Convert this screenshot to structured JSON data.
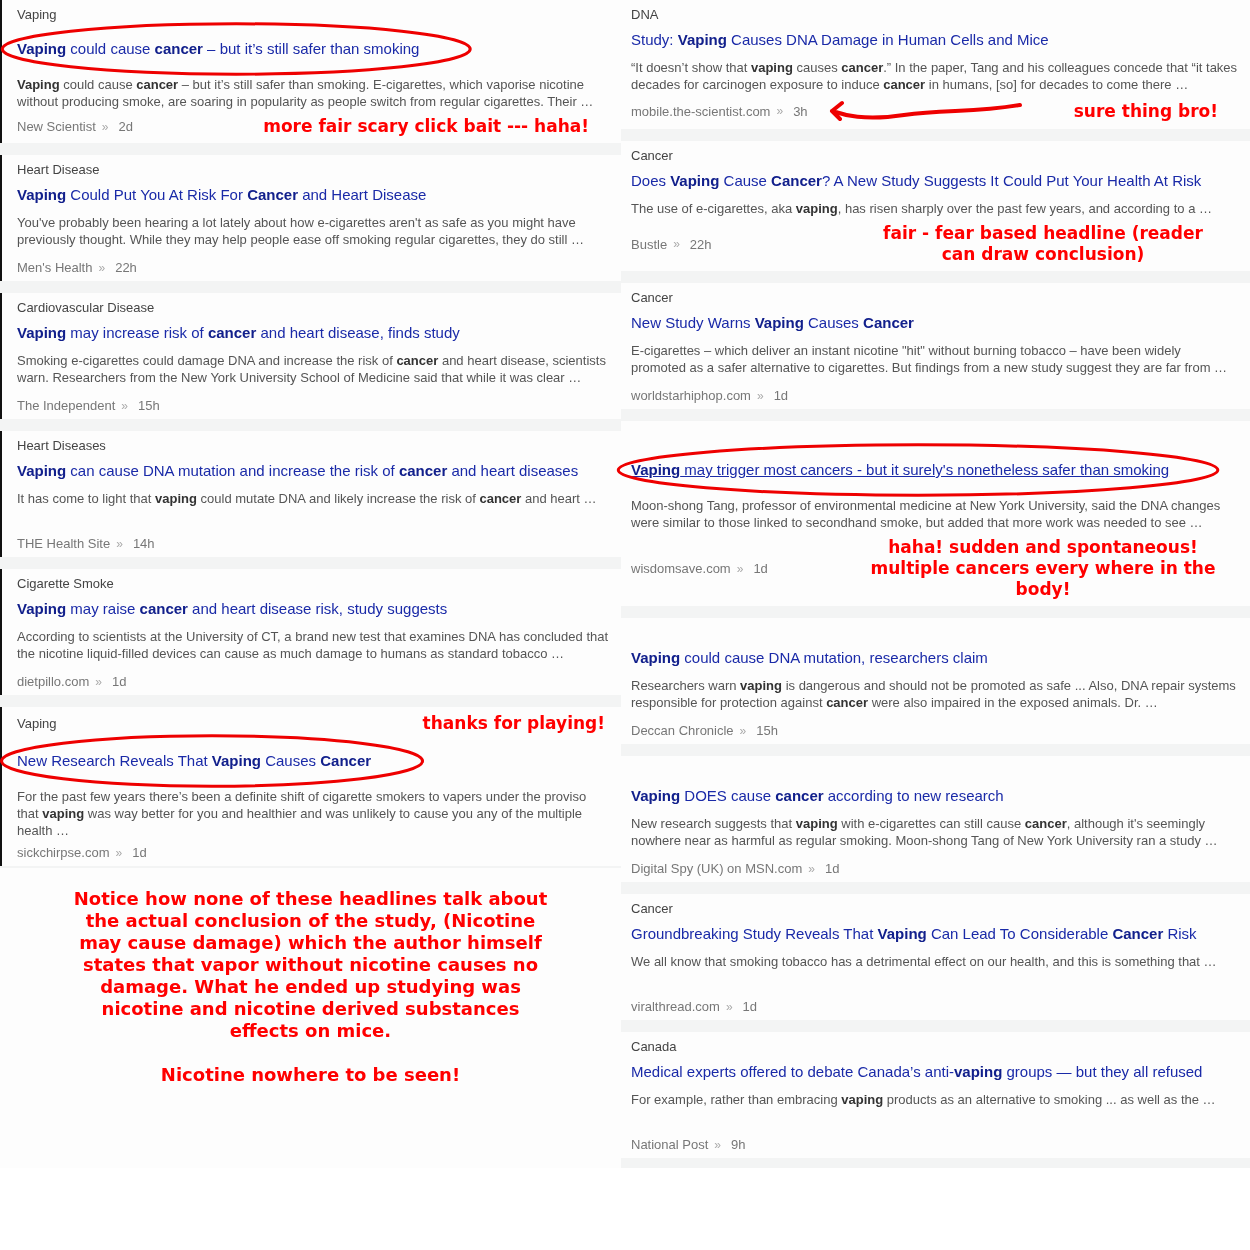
{
  "left": [
    {
      "topic": "Vaping",
      "headline": "**Vaping** could cause **cancer** – but it’s still safer than smoking",
      "snippet": "**Vaping** could cause **cancer** – but it’s still safer than smoking. E-cigarettes, which vaporise nicotine without producing smoke, are soaring in popularity as people switch from regular cigarettes. Their …",
      "source": "New Scientist",
      "separator": "»",
      "time": "2d",
      "circled": true,
      "underlined": false,
      "note": {
        "kind": "meta",
        "text": "more fair scary click bait --- haha!"
      }
    },
    {
      "topic": "Heart Disease",
      "headline": "**Vaping** Could Put You At Risk For **Cancer** and Heart Disease",
      "snippet": "You've probably been hearing a lot lately about how e-cigarettes aren't as safe as you might have previously thought. While they may help people ease off smoking regular cigarettes, they do still …",
      "source": "Men's Health",
      "separator": "»",
      "time": "22h",
      "circled": false,
      "underlined": false
    },
    {
      "topic": "Cardiovascular Disease",
      "headline": "**Vaping** may increase risk of **cancer** and heart disease, finds study",
      "snippet": "Smoking e-cigarettes could damage DNA and increase the risk of **cancer** and heart disease, scientists warn. Researchers from the New York University School of Medicine said that while it was clear …",
      "source": "The Independent",
      "separator": "»",
      "time": "15h",
      "circled": false,
      "underlined": false
    },
    {
      "topic": "Heart Diseases",
      "headline": "**Vaping** can cause DNA mutation and increase the risk of **cancer** and heart diseases",
      "snippet": "It has come to light that **vaping** could mutate DNA and likely increase the risk of **cancer** and heart …",
      "source": "THE Health Site",
      "separator": "»",
      "time": "14h",
      "circled": false,
      "underlined": false
    },
    {
      "topic": "Cigarette Smoke",
      "headline": "**Vaping** may raise **cancer** and heart disease risk, study suggests",
      "snippet": "According to scientists at the University of CT, a brand new test that examines DNA has concluded that the nicotine liquid-filled devices can cause as much damage to humans as standard tobacco …",
      "source": "dietpillo.com",
      "separator": "»",
      "time": "1d",
      "circled": false,
      "underlined": false
    },
    {
      "topic": "Vaping",
      "headline": "New Research Reveals That **Vaping** Causes **Cancer**",
      "snippet": "For the past few years there’s been a definite shift of cigarette smokers to vapers under the proviso that **vaping** was way better for you and healthier and was unlikely to cause you any of the multiple health …",
      "source": "sickchirpse.com",
      "separator": "»",
      "time": "1d",
      "circled": true,
      "underlined": false,
      "note": {
        "kind": "top",
        "text": "thanks for playing!"
      }
    }
  ],
  "commentary": [
    "Notice how none of these headlines talk about the actual conclusion of the study, (Nicotine may cause damage) which the author himself states that vapor without nicotine causes no damage. What he ended up studying was nicotine and nicotine derived substances effects on mice.",
    "Nicotine nowhere to be seen!"
  ],
  "right": [
    {
      "topic": "DNA",
      "headline": "Study: **Vaping** Causes DNA Damage in Human Cells and Mice",
      "snippet": "“It doesn’t show that **vaping** causes **cancer**.” In the paper, Tang and his colleagues concede that “it takes decades for carcinogen exposure to induce **cancer** in humans, [so] for decades to come there …",
      "source": "mobile.the-scientist.com",
      "separator": "»",
      "time": "3h",
      "circled": false,
      "underlined": false,
      "note": {
        "kind": "meta",
        "text": "sure thing bro!",
        "arrow": true
      }
    },
    {
      "topic": "Cancer",
      "headline": "Does **Vaping** Cause **Cancer**? A New Study Suggests It Could Put Your Health At Risk",
      "snippet": "The use of e-cigarettes, aka **vaping**, has risen sharply over the past few years, and according to a …",
      "source": "Bustle",
      "separator": "»",
      "time": "22h",
      "circled": false,
      "underlined": false,
      "note": {
        "kind": "meta",
        "text": "fair - fear based headline (reader can draw conclusion)"
      }
    },
    {
      "topic": "Cancer",
      "headline": "New Study Warns **Vaping** Causes **Cancer**",
      "snippet": "E-cigarettes – which deliver an instant nicotine \"hit\" without burning tobacco – have been widely promoted as a safer alternative to cigarettes. But findings from a new study suggest they are far from …",
      "source": "worldstarhiphop.com",
      "separator": "»",
      "time": "1d",
      "circled": false,
      "underlined": false
    },
    {
      "headline": "**Vaping** may trigger most cancers - but it surely's nonetheless safer than smoking",
      "snippet": "Moon-shong Tang, professor of environmental medicine at New York University, said the DNA changes were similar to those linked to secondhand smoke, but added that more work was needed to see …",
      "source": "wisdomsave.com",
      "separator": "»",
      "time": "1d",
      "circled": true,
      "underlined": true,
      "note": {
        "kind": "meta",
        "text": "haha! sudden and spontaneous! multiple cancers every where in the body!"
      }
    },
    {
      "headline": "**Vaping** could cause DNA mutation, researchers claim",
      "snippet": "Researchers warn **vaping** is dangerous and should not be promoted as safe ... Also, DNA repair systems responsible for protection against **cancer** were also impaired in the exposed animals. Dr. …",
      "source": "Deccan Chronicle",
      "separator": "»",
      "time": "15h",
      "circled": false,
      "underlined": false
    },
    {
      "headline": "**Vaping** DOES cause **cancer** according to new research",
      "snippet": "New research suggests that **vaping** with e-cigarettes can still cause **cancer**, although it's seemingly nowhere near as harmful as regular smoking. Moon-shong Tang of New York University ran a study …",
      "source": "Digital Spy (UK) on MSN.com",
      "separator": "»",
      "time": "1d",
      "circled": false,
      "underlined": false
    },
    {
      "topic": "Cancer",
      "headline": "Groundbreaking Study Reveals That **Vaping** Can Lead To Considerable **Cancer** Risk",
      "snippet": "We all know that smoking tobacco has a detrimental effect on our health, and this is something that …",
      "source": "viralthread.com",
      "separator": "»",
      "time": "1d",
      "circled": false,
      "underlined": false
    },
    {
      "topic": "Canada",
      "headline": "Medical experts offered to debate Canada’s anti-**vaping** groups — but they all refused",
      "snippet": "For example, rather than embracing **vaping** products as an alternative to smoking ... as well as the …",
      "source": "National Post",
      "separator": "»",
      "time": "9h",
      "circled": false,
      "underlined": false
    }
  ]
}
